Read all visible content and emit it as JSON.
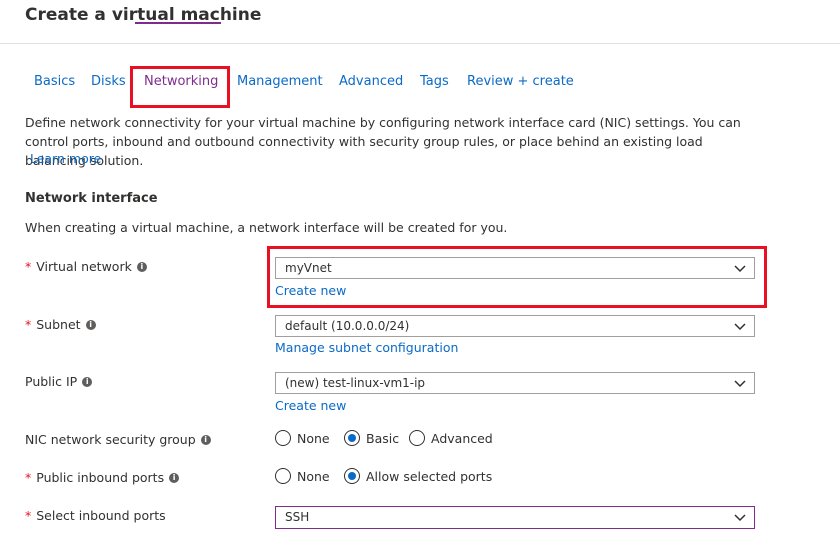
{
  "page": {
    "title": "Create a virtual machine"
  },
  "tabs": [
    {
      "label": "Basics"
    },
    {
      "label": "Disks"
    },
    {
      "label": "Networking"
    },
    {
      "label": "Management"
    },
    {
      "label": "Advanced"
    },
    {
      "label": "Tags"
    },
    {
      "label": "Review + create"
    }
  ],
  "intro": {
    "text": "Define network connectivity for your virtual machine by configuring network interface card (NIC) settings. You can control ports, inbound and outbound connectivity with security group rules, or place behind an existing load balancing solution.",
    "learn_more": "Learn more"
  },
  "network_interface": {
    "heading": "Network interface",
    "description": "When creating a virtual machine, a network interface will be created for you."
  },
  "fields": {
    "virtual_network": {
      "required": "*",
      "label": "Virtual network",
      "value": "myVnet",
      "link": "Create new"
    },
    "subnet": {
      "required": "*",
      "label": "Subnet",
      "value": "default (10.0.0.0/24)",
      "link": "Manage subnet configuration"
    },
    "public_ip": {
      "label": "Public IP",
      "value": "(new) test-linux-vm1-ip",
      "link": "Create new"
    },
    "nic_nsg": {
      "label": "NIC network security group",
      "options": [
        "None",
        "Basic",
        "Advanced"
      ],
      "selected": "Basic"
    },
    "public_inbound_ports": {
      "required": "*",
      "label": "Public inbound ports",
      "options": [
        "None",
        "Allow selected ports"
      ],
      "selected": "Allow selected ports"
    },
    "select_inbound_ports": {
      "required": "*",
      "label": "Select inbound ports",
      "value": "SSH"
    }
  },
  "icons": {
    "info": "info-icon",
    "dropdown": "chevron-down-icon"
  },
  "colors": {
    "accent": "#7e2d8d",
    "link": "#0b6ac6",
    "required": "#e81123",
    "highlight": "#e81123"
  }
}
